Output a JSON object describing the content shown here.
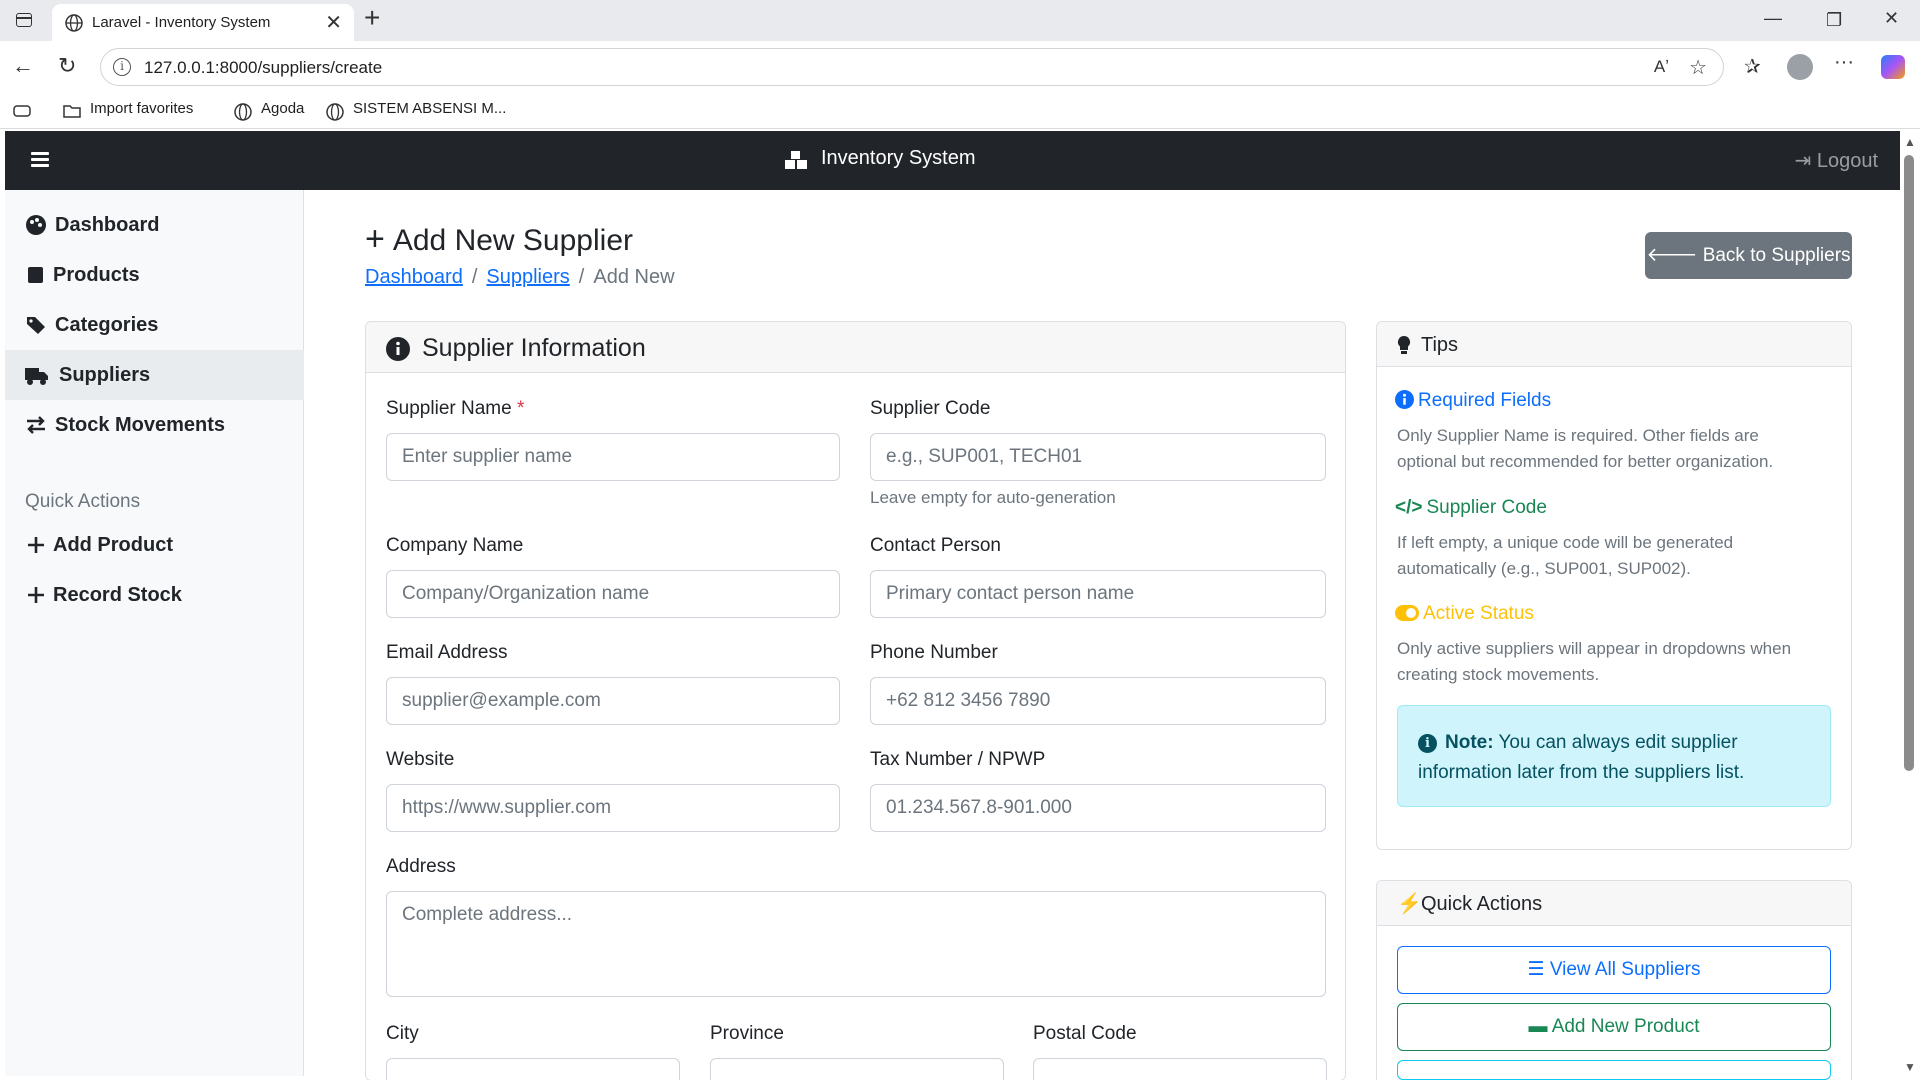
{
  "browser": {
    "tab_title": "Laravel - Inventory System",
    "url": "127.0.0.1:8000/suppliers/create",
    "favorites": [
      {
        "label": "Import favorites",
        "icon": "folder-icon"
      },
      {
        "label": "Agoda",
        "icon": "globe-icon"
      },
      {
        "label": "SISTEM ABSENSI M...",
        "icon": "globe-icon"
      }
    ]
  },
  "navbar": {
    "brand": "Inventory System",
    "logout": "Logout"
  },
  "sidebar": {
    "items": [
      {
        "label": "Dashboard",
        "icon": "palette-icon"
      },
      {
        "label": "Products",
        "icon": "box-icon"
      },
      {
        "label": "Categories",
        "icon": "tags-icon"
      },
      {
        "label": "Suppliers",
        "icon": "truck-icon",
        "active": true
      },
      {
        "label": "Stock Movements",
        "icon": "exchange-icon"
      }
    ],
    "quick_heading": "Quick Actions",
    "quick_items": [
      {
        "label": "Add Product",
        "icon": "plus-icon"
      },
      {
        "label": "Record Stock",
        "icon": "plus-icon"
      }
    ]
  },
  "page": {
    "title": "Add New Supplier",
    "breadcrumb": [
      "Dashboard",
      "Suppliers",
      "Add New"
    ],
    "back_button": "Back to Suppliers"
  },
  "form": {
    "header": "Supplier Information",
    "fields": {
      "supplier_name": {
        "label": "Supplier Name",
        "required": "*",
        "placeholder": "Enter supplier name"
      },
      "supplier_code": {
        "label": "Supplier Code",
        "placeholder": "e.g., SUP001, TECH01",
        "help": "Leave empty for auto-generation"
      },
      "company_name": {
        "label": "Company Name",
        "placeholder": "Company/Organization name"
      },
      "contact_person": {
        "label": "Contact Person",
        "placeholder": "Primary contact person name"
      },
      "email": {
        "label": "Email Address",
        "placeholder": "supplier@example.com"
      },
      "phone": {
        "label": "Phone Number",
        "placeholder": "+62 812 3456 7890"
      },
      "website": {
        "label": "Website",
        "placeholder": "https://www.supplier.com"
      },
      "tax_number": {
        "label": "Tax Number / NPWP",
        "placeholder": "01.234.567.8-901.000"
      },
      "address": {
        "label": "Address",
        "placeholder": "Complete address..."
      },
      "city": {
        "label": "City"
      },
      "province": {
        "label": "Province"
      },
      "postal_code": {
        "label": "Postal Code"
      }
    }
  },
  "tips": {
    "header": "Tips",
    "items": [
      {
        "title": "Required Fields",
        "text": "Only Supplier Name is required. Other fields are optional but recommended for better organization.",
        "color": "#0d6efd"
      },
      {
        "title": "Supplier Code",
        "text": "If left empty, a unique code will be generated automatically (e.g., SUP001, SUP002).",
        "color": "#198754"
      },
      {
        "title": "Active Status",
        "text": "Only active suppliers will appear in dropdowns when creating stock movements.",
        "color": "#ffc107"
      }
    ],
    "note_label": "Note:",
    "note_text": "You can always edit supplier information later from the suppliers list."
  },
  "quick_actions": {
    "header": "Quick Actions",
    "buttons": [
      {
        "label": "View All Suppliers",
        "color": "#0d6efd"
      },
      {
        "label": "Add New Product",
        "color": "#198754"
      }
    ]
  }
}
